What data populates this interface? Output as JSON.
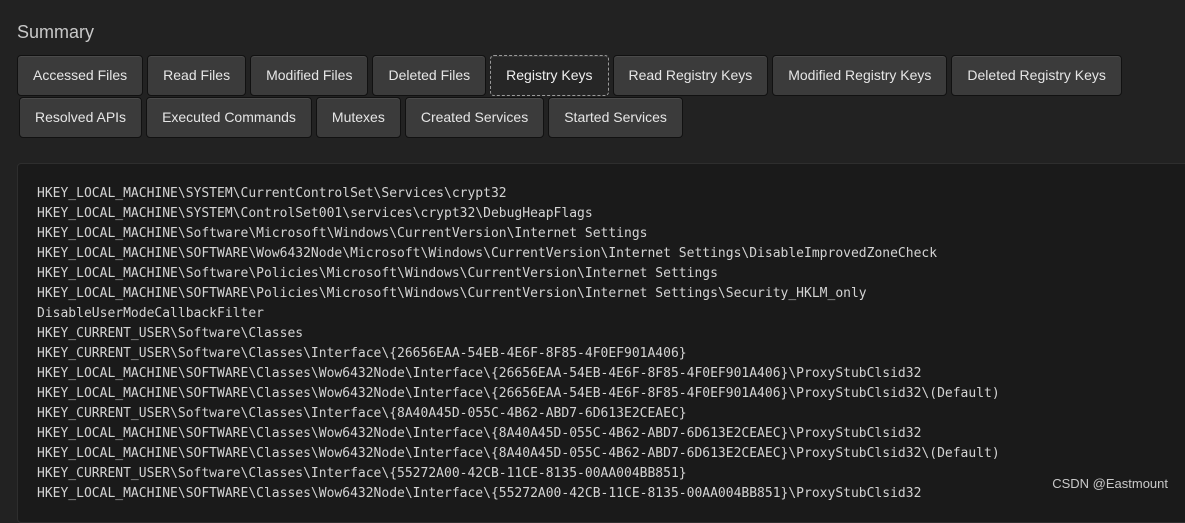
{
  "summary": {
    "title": "Summary"
  },
  "tabs_row1": [
    {
      "label": "Accessed Files"
    },
    {
      "label": "Read Files"
    },
    {
      "label": "Modified Files"
    },
    {
      "label": "Deleted Files"
    },
    {
      "label": "Registry Keys",
      "active": true
    },
    {
      "label": "Read Registry Keys"
    },
    {
      "label": "Modified Registry Keys"
    },
    {
      "label": "Deleted Registry Keys"
    }
  ],
  "tabs_row2": [
    {
      "label": "Resolved APIs"
    },
    {
      "label": "Executed Commands"
    },
    {
      "label": "Mutexes"
    },
    {
      "label": "Created Services"
    },
    {
      "label": "Started Services"
    }
  ],
  "registry_keys": [
    "HKEY_LOCAL_MACHINE\\SYSTEM\\CurrentControlSet\\Services\\crypt32",
    "HKEY_LOCAL_MACHINE\\SYSTEM\\ControlSet001\\services\\crypt32\\DebugHeapFlags",
    "HKEY_LOCAL_MACHINE\\Software\\Microsoft\\Windows\\CurrentVersion\\Internet Settings",
    "HKEY_LOCAL_MACHINE\\SOFTWARE\\Wow6432Node\\Microsoft\\Windows\\CurrentVersion\\Internet Settings\\DisableImprovedZoneCheck",
    "HKEY_LOCAL_MACHINE\\Software\\Policies\\Microsoft\\Windows\\CurrentVersion\\Internet Settings",
    "HKEY_LOCAL_MACHINE\\SOFTWARE\\Policies\\Microsoft\\Windows\\CurrentVersion\\Internet Settings\\Security_HKLM_only",
    "DisableUserModeCallbackFilter",
    "HKEY_CURRENT_USER\\Software\\Classes",
    "HKEY_CURRENT_USER\\Software\\Classes\\Interface\\{26656EAA-54EB-4E6F-8F85-4F0EF901A406}",
    "HKEY_LOCAL_MACHINE\\SOFTWARE\\Classes\\Wow6432Node\\Interface\\{26656EAA-54EB-4E6F-8F85-4F0EF901A406}\\ProxyStubClsid32",
    "HKEY_LOCAL_MACHINE\\SOFTWARE\\Classes\\Wow6432Node\\Interface\\{26656EAA-54EB-4E6F-8F85-4F0EF901A406}\\ProxyStubClsid32\\(Default)",
    "HKEY_CURRENT_USER\\Software\\Classes\\Interface\\{8A40A45D-055C-4B62-ABD7-6D613E2CEAEC}",
    "HKEY_LOCAL_MACHINE\\SOFTWARE\\Classes\\Wow6432Node\\Interface\\{8A40A45D-055C-4B62-ABD7-6D613E2CEAEC}\\ProxyStubClsid32",
    "HKEY_LOCAL_MACHINE\\SOFTWARE\\Classes\\Wow6432Node\\Interface\\{8A40A45D-055C-4B62-ABD7-6D613E2CEAEC}\\ProxyStubClsid32\\(Default)",
    "HKEY_CURRENT_USER\\Software\\Classes\\Interface\\{55272A00-42CB-11CE-8135-00AA004BB851}",
    "HKEY_LOCAL_MACHINE\\SOFTWARE\\Classes\\Wow6432Node\\Interface\\{55272A00-42CB-11CE-8135-00AA004BB851}\\ProxyStubClsid32"
  ],
  "watermark": "CSDN @Eastmount"
}
